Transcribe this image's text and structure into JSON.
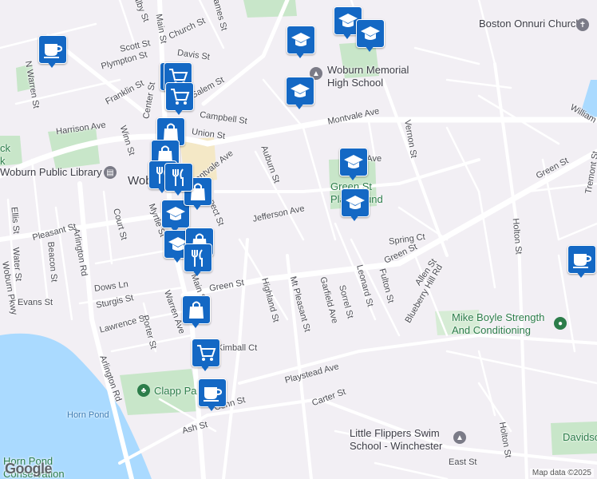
{
  "map": {
    "attribution": "Map data ©2025",
    "logo": "Google",
    "colors": {
      "background": "#f2eff4",
      "water": "#aadaff",
      "park": "#c8e6c9",
      "road": "#ffffff",
      "pin": "#1468c4"
    }
  },
  "streets": [
    "Salby St",
    "Main St",
    "James St",
    "Scott St",
    "Church St",
    "Plympton St",
    "Davis St",
    "Franklin St",
    "Center St",
    "Salem St",
    "Campbell St",
    "Union St",
    "Harrison Ave",
    "Winn St",
    "Montvale Ave",
    "Montvale Ave",
    "Auburn St",
    "Vernon St",
    "Green St",
    "Tremont St",
    "William St",
    "Holton St",
    "Court St",
    "Pleasant St",
    "Beacon St",
    "Ellis St",
    "Water St",
    "Myrtle St",
    "Prospect St",
    "Jefferson Ave",
    "Spring Ct",
    "Green St",
    "Allen St",
    "Dows Ln",
    "Sturgis St",
    "Evans St",
    "Lawrence St",
    "Porter St",
    "Warren Ave",
    "Main St",
    "Green St",
    "Highland St",
    "Mt Pleasant St",
    "Garfield Ave",
    "Sorrel St",
    "Leonard St",
    "Fulton St",
    "Blueberry Hill Rd",
    "Arlington Rd",
    "Arlington Rd",
    "N Warren St",
    "Woburn Pkwy",
    "Playstead Ave",
    "Carter St",
    "Conn St",
    "Ash St",
    "East St",
    "Holton St",
    "Lake Ave",
    "Kimball Ct"
  ],
  "places": {
    "boston_onnuri": "Boston Onnuri Church",
    "woburn_memorial": "Woburn Memorial High School",
    "woburn_library": "Woburn Public Library",
    "woburn_center": "Wob",
    "green_st_playground": "Green St Playground",
    "mike_boyle": "Mike Boyle Strength And Conditioning",
    "clapp_park": "Clapp Pa",
    "horn_pond": "Horn Pond",
    "horn_pond_conservation": "Horn Pond Conservation",
    "little_flippers": "Little Flippers Swim School - Winchester",
    "davidson_park": "Davidson Pa",
    "black_brook": "ck k"
  },
  "pins": [
    {
      "icon": "education"
    },
    {
      "icon": "education"
    },
    {
      "icon": "education"
    },
    {
      "icon": "education"
    },
    {
      "icon": "education"
    },
    {
      "icon": "education"
    },
    {
      "icon": "education"
    },
    {
      "icon": "education"
    },
    {
      "icon": "coffee"
    },
    {
      "icon": "coffee"
    },
    {
      "icon": "coffee"
    },
    {
      "icon": "shopping"
    },
    {
      "icon": "shopping"
    },
    {
      "icon": "shopping"
    },
    {
      "icon": "shopping"
    },
    {
      "icon": "shopping"
    },
    {
      "icon": "shopping"
    },
    {
      "icon": "cart"
    },
    {
      "icon": "cart"
    },
    {
      "icon": "cart"
    },
    {
      "icon": "restaurant"
    },
    {
      "icon": "restaurant"
    },
    {
      "icon": "restaurant"
    }
  ]
}
